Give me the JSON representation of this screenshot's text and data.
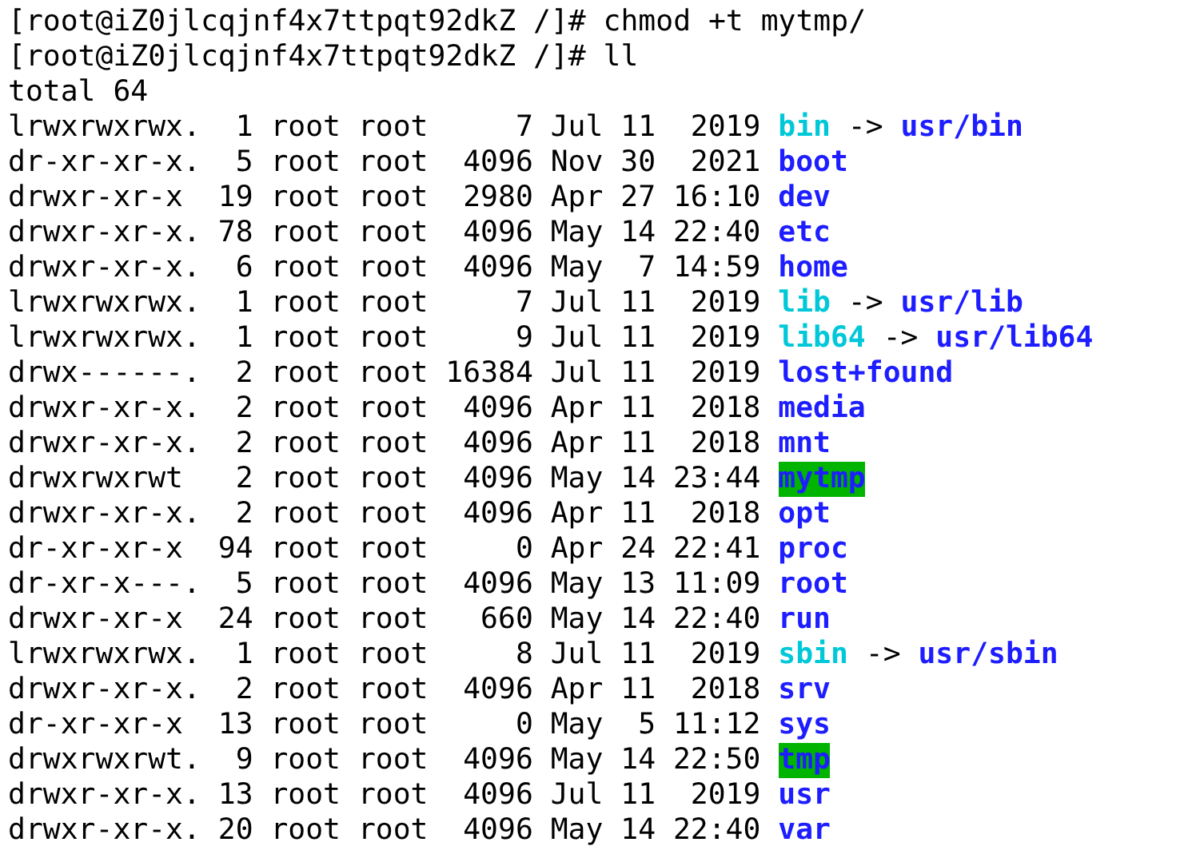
{
  "terminal": {
    "lines": [
      {
        "kind": "prompt",
        "prompt": "[root@iZ0jlcqjnf4x7ttpqt92dkZ /]#",
        "command": "chmod +t mytmp/"
      },
      {
        "kind": "prompt",
        "prompt": "[root@iZ0jlcqjnf4x7ttpqt92dkZ /]#",
        "command": "ll"
      },
      {
        "kind": "output",
        "text": "total 64"
      }
    ],
    "listing": [
      {
        "kind": "link",
        "perms": "lrwxrwxrwx.",
        "links": "1",
        "owner": "root",
        "group": "root",
        "size": "7",
        "month": "Jul",
        "day": "11",
        "time": "2019",
        "name": "bin",
        "arrow": "->",
        "target": "usr/bin"
      },
      {
        "kind": "dir",
        "perms": "dr-xr-xr-x.",
        "links": "5",
        "owner": "root",
        "group": "root",
        "size": "4096",
        "month": "Nov",
        "day": "30",
        "time": "2021",
        "name": "boot"
      },
      {
        "kind": "dir",
        "perms": "drwxr-xr-x",
        "links": "19",
        "owner": "root",
        "group": "root",
        "size": "2980",
        "month": "Apr",
        "day": "27",
        "time": "16:10",
        "name": "dev"
      },
      {
        "kind": "dir",
        "perms": "drwxr-xr-x.",
        "links": "78",
        "owner": "root",
        "group": "root",
        "size": "4096",
        "month": "May",
        "day": "14",
        "time": "22:40",
        "name": "etc"
      },
      {
        "kind": "dir",
        "perms": "drwxr-xr-x.",
        "links": "6",
        "owner": "root",
        "group": "root",
        "size": "4096",
        "month": "May",
        "day": "7",
        "time": "14:59",
        "name": "home"
      },
      {
        "kind": "link",
        "perms": "lrwxrwxrwx.",
        "links": "1",
        "owner": "root",
        "group": "root",
        "size": "7",
        "month": "Jul",
        "day": "11",
        "time": "2019",
        "name": "lib",
        "arrow": "->",
        "target": "usr/lib"
      },
      {
        "kind": "link",
        "perms": "lrwxrwxrwx.",
        "links": "1",
        "owner": "root",
        "group": "root",
        "size": "9",
        "month": "Jul",
        "day": "11",
        "time": "2019",
        "name": "lib64",
        "arrow": "->",
        "target": "usr/lib64"
      },
      {
        "kind": "dir",
        "perms": "drwx------.",
        "links": "2",
        "owner": "root",
        "group": "root",
        "size": "16384",
        "month": "Jul",
        "day": "11",
        "time": "2019",
        "name": "lost+found"
      },
      {
        "kind": "dir",
        "perms": "drwxr-xr-x.",
        "links": "2",
        "owner": "root",
        "group": "root",
        "size": "4096",
        "month": "Apr",
        "day": "11",
        "time": "2018",
        "name": "media"
      },
      {
        "kind": "dir",
        "perms": "drwxr-xr-x.",
        "links": "2",
        "owner": "root",
        "group": "root",
        "size": "4096",
        "month": "Apr",
        "day": "11",
        "time": "2018",
        "name": "mnt"
      },
      {
        "kind": "sticky",
        "perms": "drwxrwxrwt",
        "links": "2",
        "owner": "root",
        "group": "root",
        "size": "4096",
        "month": "May",
        "day": "14",
        "time": "23:44",
        "name": "mytmp"
      },
      {
        "kind": "dir",
        "perms": "drwxr-xr-x.",
        "links": "2",
        "owner": "root",
        "group": "root",
        "size": "4096",
        "month": "Apr",
        "day": "11",
        "time": "2018",
        "name": "opt"
      },
      {
        "kind": "dir",
        "perms": "dr-xr-xr-x",
        "links": "94",
        "owner": "root",
        "group": "root",
        "size": "0",
        "month": "Apr",
        "day": "24",
        "time": "22:41",
        "name": "proc"
      },
      {
        "kind": "dir",
        "perms": "dr-xr-x---.",
        "links": "5",
        "owner": "root",
        "group": "root",
        "size": "4096",
        "month": "May",
        "day": "13",
        "time": "11:09",
        "name": "root"
      },
      {
        "kind": "dir",
        "perms": "drwxr-xr-x",
        "links": "24",
        "owner": "root",
        "group": "root",
        "size": "660",
        "month": "May",
        "day": "14",
        "time": "22:40",
        "name": "run"
      },
      {
        "kind": "link",
        "perms": "lrwxrwxrwx.",
        "links": "1",
        "owner": "root",
        "group": "root",
        "size": "8",
        "month": "Jul",
        "day": "11",
        "time": "2019",
        "name": "sbin",
        "arrow": "->",
        "target": "usr/sbin"
      },
      {
        "kind": "dir",
        "perms": "drwxr-xr-x.",
        "links": "2",
        "owner": "root",
        "group": "root",
        "size": "4096",
        "month": "Apr",
        "day": "11",
        "time": "2018",
        "name": "srv"
      },
      {
        "kind": "dir",
        "perms": "dr-xr-xr-x",
        "links": "13",
        "owner": "root",
        "group": "root",
        "size": "0",
        "month": "May",
        "day": "5",
        "time": "11:12",
        "name": "sys"
      },
      {
        "kind": "sticky",
        "perms": "drwxrwxrwt.",
        "links": "9",
        "owner": "root",
        "group": "root",
        "size": "4096",
        "month": "May",
        "day": "14",
        "time": "22:50",
        "name": "tmp"
      },
      {
        "kind": "dir",
        "perms": "drwxr-xr-x.",
        "links": "13",
        "owner": "root",
        "group": "root",
        "size": "4096",
        "month": "Jul",
        "day": "11",
        "time": "2019",
        "name": "usr"
      },
      {
        "kind": "dir",
        "perms": "drwxr-xr-x.",
        "links": "20",
        "owner": "root",
        "group": "root",
        "size": "4096",
        "month": "May",
        "day": "14",
        "time": "22:40",
        "name": "var"
      }
    ]
  }
}
